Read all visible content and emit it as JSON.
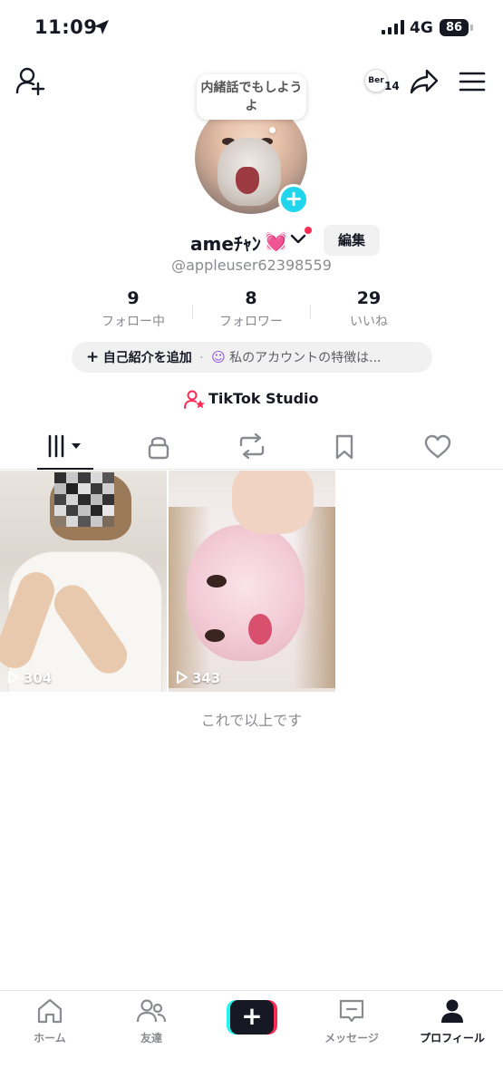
{
  "status_bar": {
    "time": "11:09",
    "network": "4G",
    "battery": "86"
  },
  "header": {
    "ber_badge_text": "Ber",
    "ber_badge_count": "14"
  },
  "profile": {
    "bubble_text": "内緒話でもしようよ",
    "display_name": "ameﾁｬﾝ",
    "display_name_emoji": "💓",
    "edit_label": "編集",
    "handle": "@appleuser62398559",
    "stats": [
      {
        "value": "9",
        "label": "フォロー中"
      },
      {
        "value": "8",
        "label": "フォロワー"
      },
      {
        "value": "29",
        "label": "いいね"
      }
    ],
    "bio_add_label": "自己紹介を追加",
    "bio_feature_label": "私のアカウントの特徴は...",
    "studio_label": "TikTok Studio"
  },
  "videos": [
    {
      "views": "304"
    },
    {
      "views": "343"
    }
  ],
  "end_text": "これで以上です",
  "bottom_nav": {
    "home": "ホーム",
    "friends": "友達",
    "messages": "メッセージ",
    "profile": "プロフィール"
  },
  "colors": {
    "accent_cyan": "#20d5ec",
    "accent_red": "#fe2c55",
    "text": "#161823",
    "muted": "#8a8b91"
  }
}
